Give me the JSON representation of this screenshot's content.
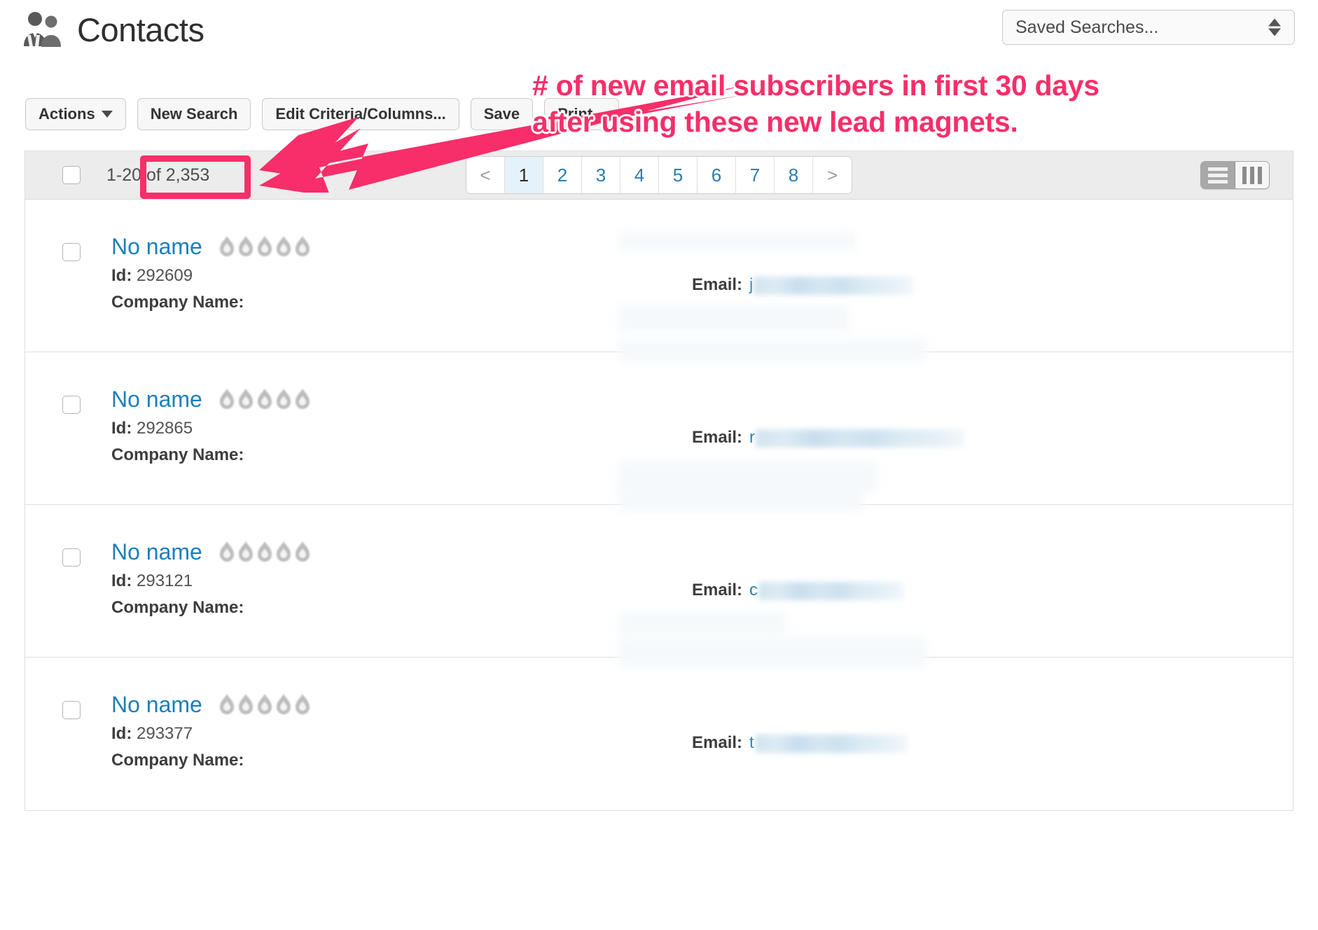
{
  "header": {
    "title": "Contacts",
    "icon": "contacts-people-icon"
  },
  "saved_searches": {
    "selected": "Saved Searches...",
    "options": [
      "Saved Searches..."
    ]
  },
  "toolbar": {
    "actions_label": "Actions",
    "new_search_label": "New Search",
    "edit_criteria_label": "Edit Criteria/Columns...",
    "save_label": "Save",
    "print_label": "Print..."
  },
  "results": {
    "count_prefix": "1-20",
    "count_suffix": " of 2,353",
    "count_text": "1-20 of 2,353",
    "pagination": {
      "prev_label": "<",
      "next_label": ">",
      "pages": [
        "1",
        "2",
        "3",
        "4",
        "5",
        "6",
        "7",
        "8"
      ],
      "active_page": "1"
    },
    "view_toggle": {
      "list_label": "list-view",
      "column_label": "column-view",
      "active": "column-view"
    },
    "field_labels": {
      "id": "Id:",
      "company": "Company Name:",
      "email": "Email:"
    },
    "rows": [
      {
        "name": "No name",
        "rating": 5,
        "id": "292609",
        "company": "",
        "email_visible_prefix": "j",
        "email_blur_width": 228
      },
      {
        "name": "No name",
        "rating": 5,
        "id": "292865",
        "company": "",
        "email_visible_prefix": "r",
        "email_blur_width": 298
      },
      {
        "name": "No name",
        "rating": 5,
        "id": "293121",
        "company": "",
        "email_visible_prefix": "c",
        "email_blur_width": 208
      },
      {
        "name": "No name",
        "rating": 5,
        "id": "293377",
        "company": "",
        "email_visible_prefix": "t",
        "email_blur_width": 218
      }
    ]
  },
  "annotation": {
    "line1": "# of new email subscribers in first 30 days",
    "line2": "after using these new lead magnets.",
    "color": "#f72e69",
    "arrow": "arrow-pointing-to-result-count",
    "highlight_target": "of 2,353"
  }
}
